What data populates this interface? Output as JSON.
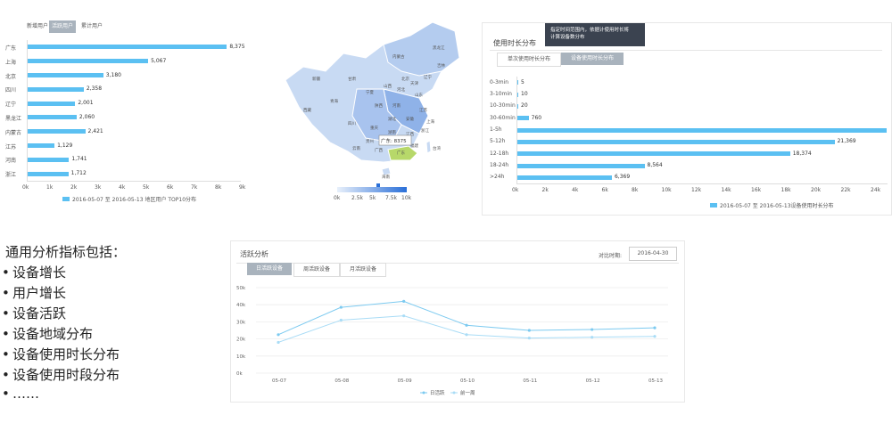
{
  "region_panel": {
    "tabs": [
      {
        "label": "新增用户",
        "active": false
      },
      {
        "label": "活跃用户",
        "active": true
      },
      {
        "label": "累计用户",
        "active": false
      }
    ],
    "legend": "2016-05-07 至 2016-05-13 地区用户 TOP10分布"
  },
  "china_map": {
    "provinces": [
      "新疆",
      "西藏",
      "青海",
      "甘肃",
      "内蒙古",
      "黑龙江",
      "吉林",
      "辽宁",
      "宁夏",
      "山西",
      "河北",
      "北京",
      "天津",
      "山东",
      "陕西",
      "河南",
      "江苏",
      "四川",
      "湖北",
      "安徽",
      "上海",
      "重庆",
      "湖南",
      "江西",
      "浙江",
      "贵州",
      "福建",
      "云南",
      "广西",
      "广东",
      "台湾",
      "海南"
    ],
    "tooltip": "广东: 8375",
    "scale_labels": [
      "0k",
      "2.5k",
      "5k",
      "7.5k",
      "10k"
    ]
  },
  "duration_panel": {
    "title": "使用时长分布",
    "tooltip_line1": "指定时间范围内，依据计使用时长将",
    "tooltip_line2": "计算设备数分布",
    "tabs": [
      {
        "label": "单次使用时长分布",
        "active": false
      },
      {
        "label": "设备使用时长分布",
        "active": true
      }
    ],
    "legend": "2016-05-07 至 2016-05-13设备使用时长分布"
  },
  "summary": {
    "heading": "通用分析指标包括：",
    "items": [
      "设备增长",
      "用户增长",
      "设备活跃",
      "设备地域分布",
      "设备使用时长分布",
      "设备使用时段分布",
      "……"
    ]
  },
  "activity_panel": {
    "title": "活跃分析",
    "date_label": "对比时期:",
    "date_value": "2016-04-30",
    "tabs": [
      {
        "label": "日活跃设备",
        "active": true
      },
      {
        "label": "周活跃设备",
        "active": false
      },
      {
        "label": "月活跃设备",
        "active": false
      }
    ]
  },
  "colors": {
    "bar": "#5bc0f2",
    "line_main": "#7ccaf0",
    "line_prev": "#a9dcf6",
    "tab_active": "#a9b3bd"
  },
  "chart_data": [
    {
      "type": "bar",
      "orientation": "horizontal",
      "categories": [
        "广东",
        "上海",
        "北京",
        "四川",
        "辽宁",
        "黑龙江",
        "内蒙古",
        "江苏",
        "河南",
        "浙江"
      ],
      "values": [
        8375,
        5067,
        3180,
        2358,
        2001,
        2060,
        2421,
        1129,
        1741,
        1712
      ],
      "value_labels": [
        "8,375",
        "5,067",
        "3,180",
        "2,358",
        "2,001",
        "2,060",
        "2,421",
        "1,129",
        "1,741",
        "1,712"
      ],
      "x_ticks": [
        "0k",
        "1k",
        "2k",
        "3k",
        "4k",
        "5k",
        "6k",
        "7k",
        "8k",
        "9k"
      ],
      "xlim": [
        0,
        9000
      ],
      "legend": "2016-05-07 至 2016-05-13 地区用户 TOP10分布"
    },
    {
      "type": "bar",
      "orientation": "horizontal",
      "categories": [
        "0-3min",
        "3-10min",
        "10-30min",
        "30-60min",
        "1-5h",
        "5-12h",
        "12-18h",
        "18-24h",
        ">24h"
      ],
      "values": [
        5,
        10,
        20,
        760,
        24900,
        21369,
        18374,
        8564,
        6369
      ],
      "value_labels": [
        "5",
        "10",
        "20",
        "760",
        "",
        "21,369",
        "18,374",
        "8,564",
        "6,369"
      ],
      "x_ticks": [
        "0k",
        "2k",
        "4k",
        "6k",
        "8k",
        "10k",
        "12k",
        "14k",
        "16k",
        "18k",
        "20k",
        "22k",
        "24k"
      ],
      "xlim": [
        0,
        25000
      ],
      "legend": "2016-05-07 至 2016-05-13设备使用时长分布"
    },
    {
      "type": "line",
      "categories": [
        "05-07",
        "05-08",
        "05-09",
        "05-10",
        "05-11",
        "05-12",
        "05-13"
      ],
      "y_ticks": [
        "0k",
        "10k",
        "20k",
        "30k",
        "40k",
        "50k"
      ],
      "ylim": [
        0,
        50000
      ],
      "series": [
        {
          "name": "日活跃",
          "values": [
            22500,
            38500,
            42000,
            28000,
            25000,
            25500,
            26500
          ]
        },
        {
          "name": "前一周",
          "values": [
            18000,
            31000,
            33500,
            22500,
            20500,
            21000,
            21500
          ]
        }
      ]
    }
  ]
}
